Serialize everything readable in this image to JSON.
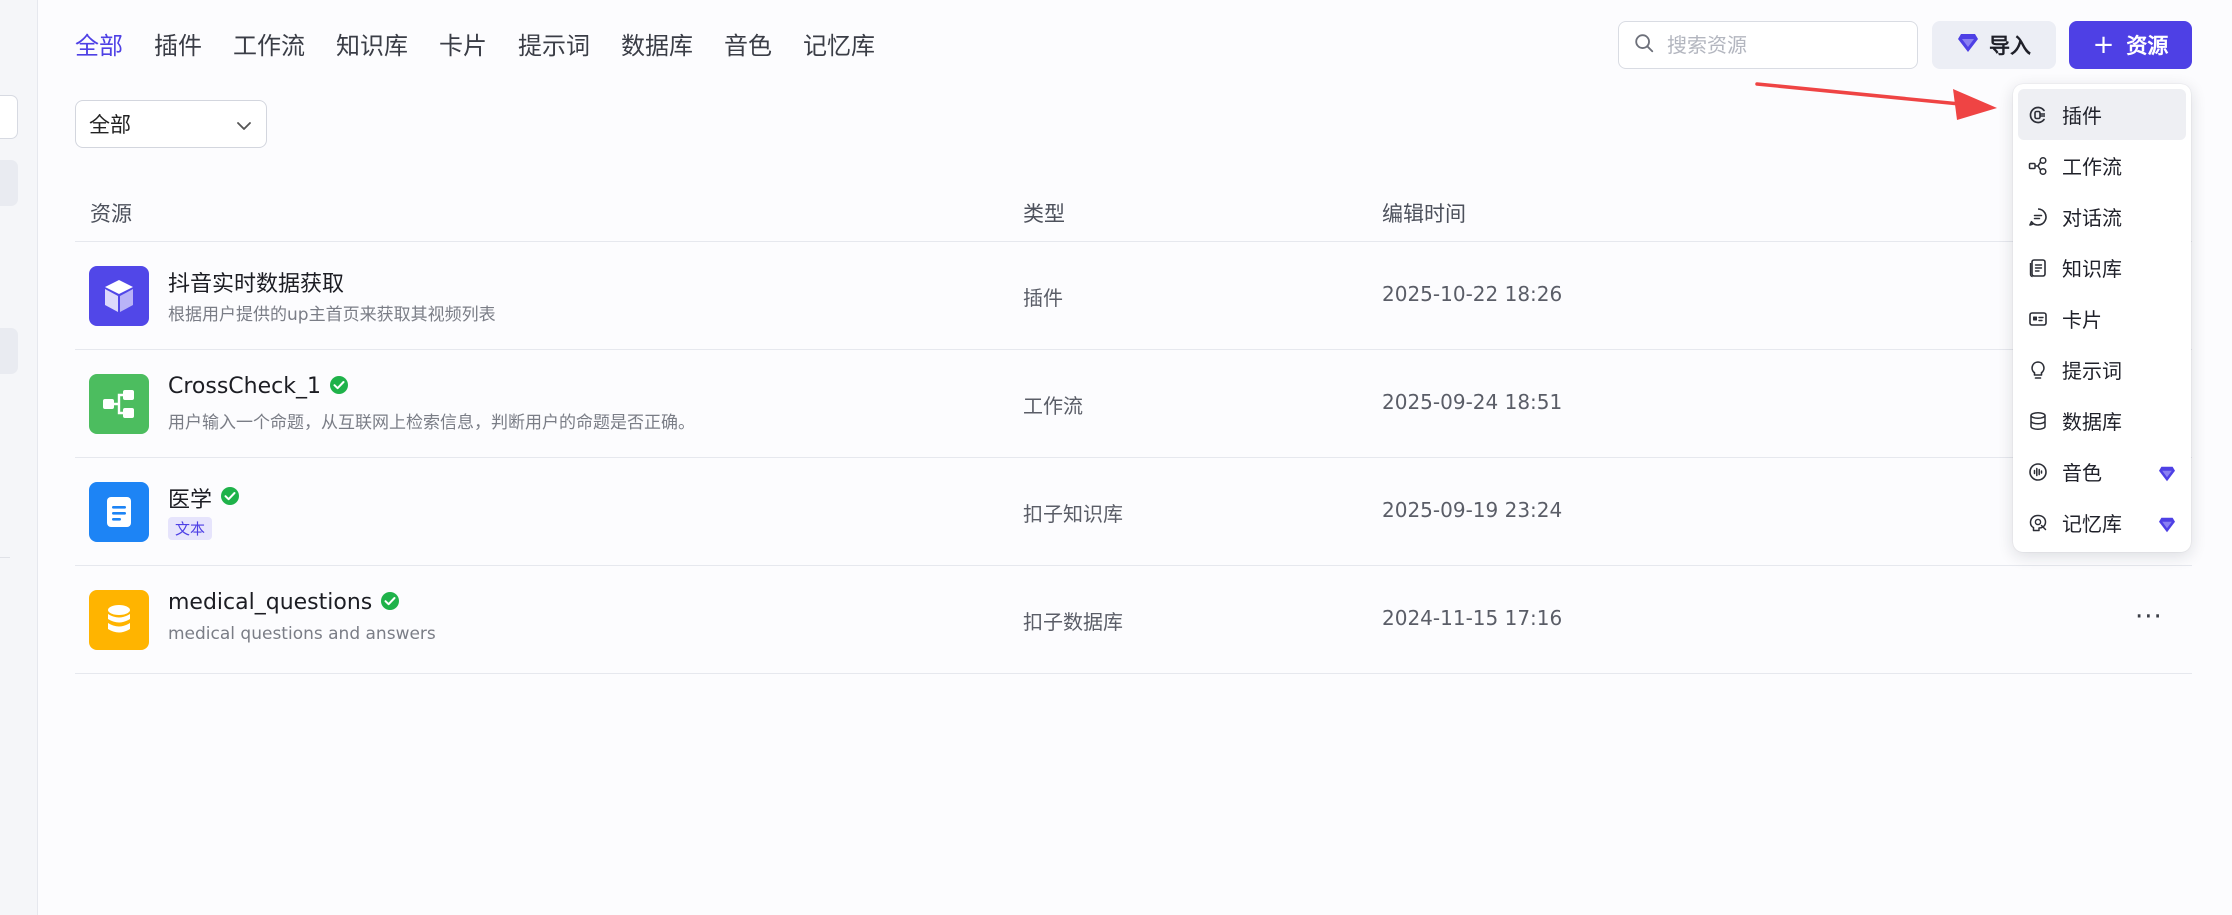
{
  "tabs": [
    {
      "label": "全部",
      "active": true
    },
    {
      "label": "插件",
      "active": false
    },
    {
      "label": "工作流",
      "active": false
    },
    {
      "label": "知识库",
      "active": false
    },
    {
      "label": "卡片",
      "active": false
    },
    {
      "label": "提示词",
      "active": false
    },
    {
      "label": "数据库",
      "active": false
    },
    {
      "label": "音色",
      "active": false
    },
    {
      "label": "记忆库",
      "active": false
    }
  ],
  "search": {
    "placeholder": "搜索资源",
    "value": ""
  },
  "import_button": {
    "label": "导入",
    "icon": "gem-icon"
  },
  "resource_button": {
    "label": "资源",
    "icon": "plus-icon"
  },
  "filter": {
    "selected": "全部"
  },
  "table": {
    "headers": {
      "resource": "资源",
      "type": "类型",
      "edited": "编辑时间"
    },
    "rows": [
      {
        "title": "抖音实时数据获取",
        "description": "根据用户提供的up主首页来获取其视频列表",
        "type": "插件",
        "time": "2025-10-22 18:26",
        "verified": false,
        "icon": "cube-icon",
        "color": "#5147e8"
      },
      {
        "title": "CrossCheck_1",
        "description": "用户输入一个命题，从互联网上检索信息，判断用户的命题是否正确。",
        "type": "工作流",
        "time": "2025-09-24 18:51",
        "verified": true,
        "icon": "workflow-icon",
        "color": "#4cbd5f"
      },
      {
        "title": "医学",
        "tag": "文本",
        "type": "扣子知识库",
        "time": "2025-09-19 23:24",
        "verified": true,
        "icon": "document-icon",
        "color": "#1d84f5"
      },
      {
        "title": "medical_questions",
        "description": "medical questions and answers",
        "type": "扣子数据库",
        "time": "2024-11-15 17:16",
        "verified": true,
        "icon": "database-icon",
        "color": "#ffb400",
        "more": "···"
      }
    ]
  },
  "dropdown": {
    "items": [
      {
        "label": "插件",
        "icon": "plugin-icon",
        "premium": false
      },
      {
        "label": "工作流",
        "icon": "workflow-icon",
        "premium": false
      },
      {
        "label": "对话流",
        "icon": "chatflow-icon",
        "premium": false
      },
      {
        "label": "知识库",
        "icon": "knowledge-icon",
        "premium": false
      },
      {
        "label": "卡片",
        "icon": "card-icon",
        "premium": false
      },
      {
        "label": "提示词",
        "icon": "prompt-icon",
        "premium": false
      },
      {
        "label": "数据库",
        "icon": "database-icon",
        "premium": false
      },
      {
        "label": "音色",
        "icon": "voice-icon",
        "premium": true
      },
      {
        "label": "记忆库",
        "icon": "memory-icon",
        "premium": true
      }
    ]
  },
  "colors": {
    "accent": "#4e40e5",
    "annotation_arrow": "#ef4444",
    "verified": "#1fb24a"
  }
}
